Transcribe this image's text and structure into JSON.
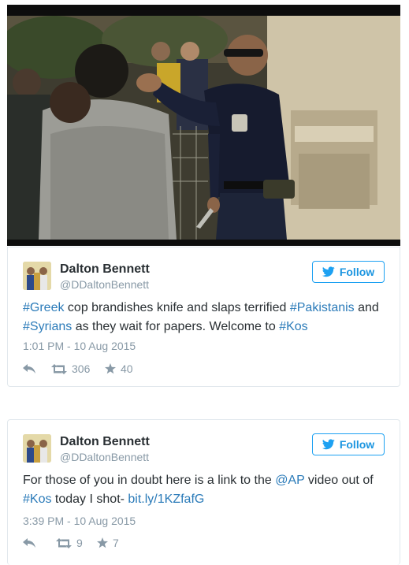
{
  "tweets": [
    {
      "name": "Dalton Bennett",
      "handle": "@DDaltonBennett",
      "follow_label": "Follow",
      "text": [
        {
          "t": "#Greek",
          "link": true
        },
        {
          "t": " cop brandishes knife and slaps terrified ",
          "link": false
        },
        {
          "t": "#Pakistanis",
          "link": true
        },
        {
          "t": " and ",
          "link": false
        },
        {
          "t": "#Syrians",
          "link": true
        },
        {
          "t": " as they wait for papers. Welcome to ",
          "link": false
        },
        {
          "t": "#Kos",
          "link": true
        }
      ],
      "timestamp": "1:01 PM - 10 Aug 2015",
      "retweets": "306",
      "likes": "40"
    },
    {
      "name": "Dalton Bennett",
      "handle": "@DDaltonBennett",
      "follow_label": "Follow",
      "text": [
        {
          "t": "For those of you in doubt here is a link to the ",
          "link": false
        },
        {
          "t": "@AP",
          "link": true
        },
        {
          "t": " video out of ",
          "link": false
        },
        {
          "t": "#Kos",
          "link": true
        },
        {
          "t": " today I shot- ",
          "link": false
        },
        {
          "t": "bit.ly/1KZfafG",
          "link": true
        }
      ],
      "timestamp": "3:39 PM - 10 Aug 2015",
      "retweets": "9",
      "likes": "7"
    }
  ],
  "colors": {
    "link": "#2b7bb9",
    "follow": "#1b95e0",
    "meta": "#8899a6",
    "text": "#292f33"
  },
  "icons": {
    "reply": "reply-icon",
    "retweet": "retweet-icon",
    "like": "star-icon",
    "follow": "twitter-bird-icon"
  }
}
